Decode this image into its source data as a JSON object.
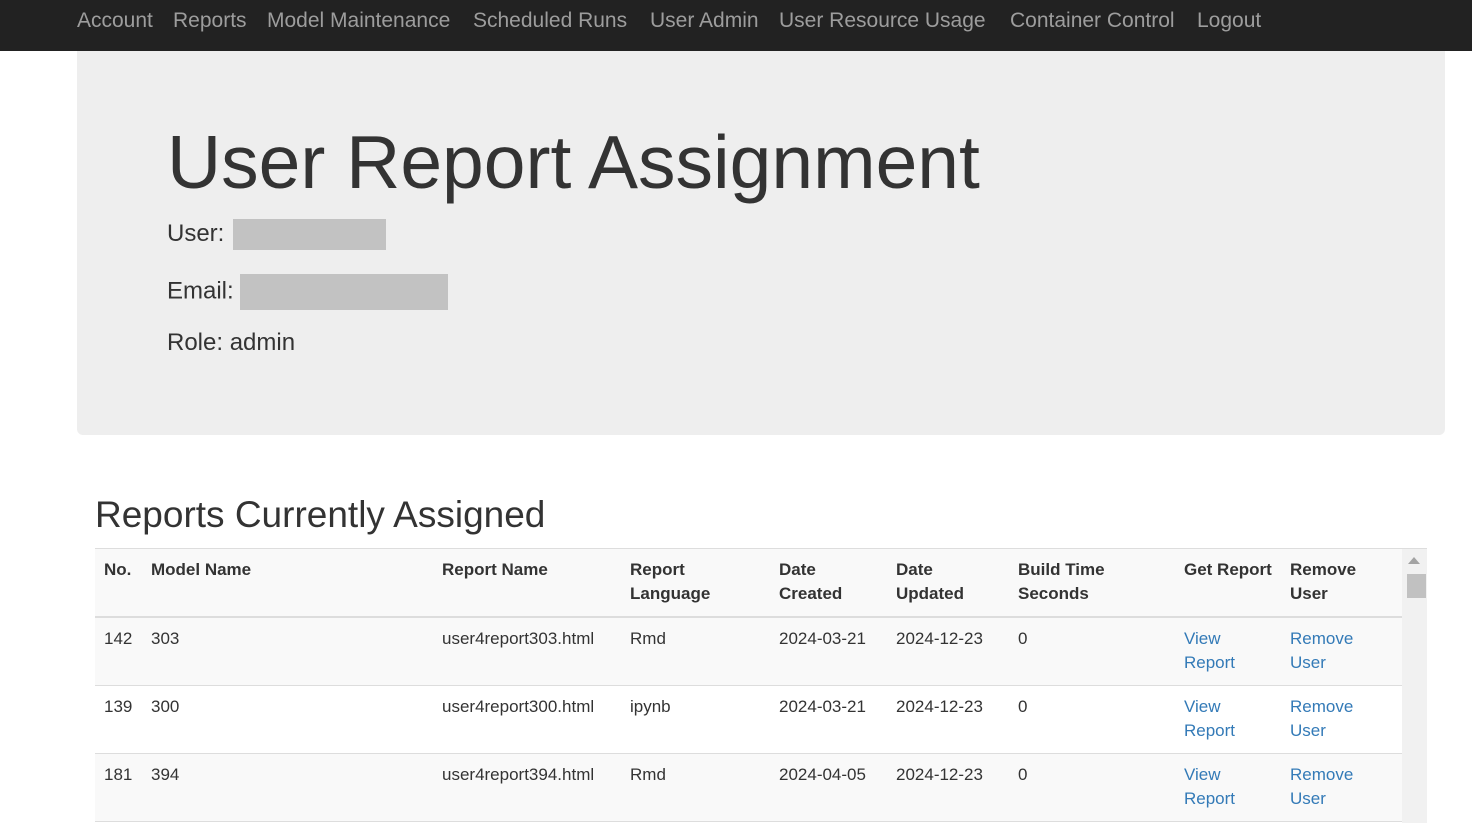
{
  "nav": {
    "items": [
      "Account",
      "Reports",
      "Model Maintenance",
      "Scheduled Runs",
      "User Admin",
      "User Resource Usage",
      "Container Control",
      "Logout"
    ]
  },
  "header": {
    "title": "User Report Assignment",
    "user_label": "User:",
    "email_label": "Email:",
    "role_label": "Role:",
    "role_value": "admin"
  },
  "reports": {
    "section_title": "Reports Currently Assigned",
    "columns": [
      "No.",
      "Model Name",
      "Report Name",
      "Report Language",
      "Date Created",
      "Date Updated",
      "Build Time Seconds",
      "Get Report",
      "Remove User"
    ],
    "rows": [
      {
        "no": "142",
        "model": "303",
        "report": "user4report303.html",
        "lang": "Rmd",
        "created": "2024-03-21",
        "updated": "2024-12-23",
        "build": "0",
        "get": "View Report",
        "remove": "Remove User"
      },
      {
        "no": "139",
        "model": "300",
        "report": "user4report300.html",
        "lang": "ipynb",
        "created": "2024-03-21",
        "updated": "2024-12-23",
        "build": "0",
        "get": "View Report",
        "remove": "Remove User"
      },
      {
        "no": "181",
        "model": "394",
        "report": "user4report394.html",
        "lang": "Rmd",
        "created": "2024-04-05",
        "updated": "2024-12-23",
        "build": "0",
        "get": "View Report",
        "remove": "Remove User"
      }
    ]
  },
  "colors": {
    "navbar": "#222222",
    "link": "#337ab7",
    "jumbotron": "#eeeeee"
  }
}
